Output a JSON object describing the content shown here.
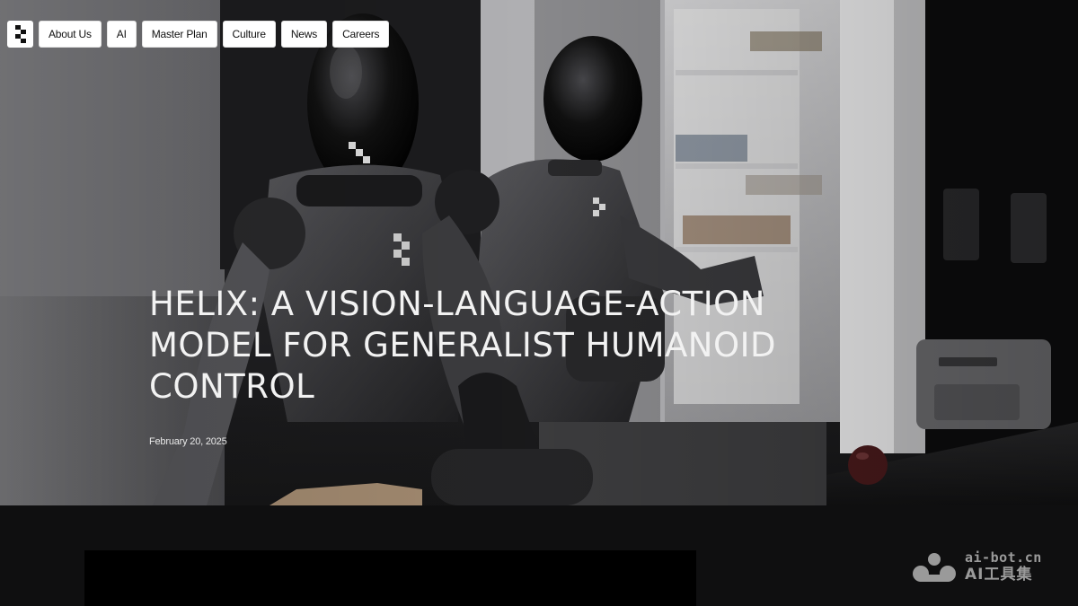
{
  "nav": {
    "items": [
      {
        "label": "About Us"
      },
      {
        "label": "AI"
      },
      {
        "label": "Master Plan"
      },
      {
        "label": "Culture"
      },
      {
        "label": "News"
      },
      {
        "label": "Careers"
      }
    ]
  },
  "hero": {
    "title": "HELIX: A VISION-LANGUAGE-ACTION MODEL FOR GENERALIST HUMANOID CONTROL",
    "date": "February 20, 2025"
  },
  "watermark": {
    "url": "ai-bot.cn",
    "name": "AI工具集"
  },
  "colors": {
    "page_bg": "#0f0f10",
    "video_bg": "#000000",
    "nav_bg": "#ffffff",
    "title_text": "#f2f2f2"
  }
}
